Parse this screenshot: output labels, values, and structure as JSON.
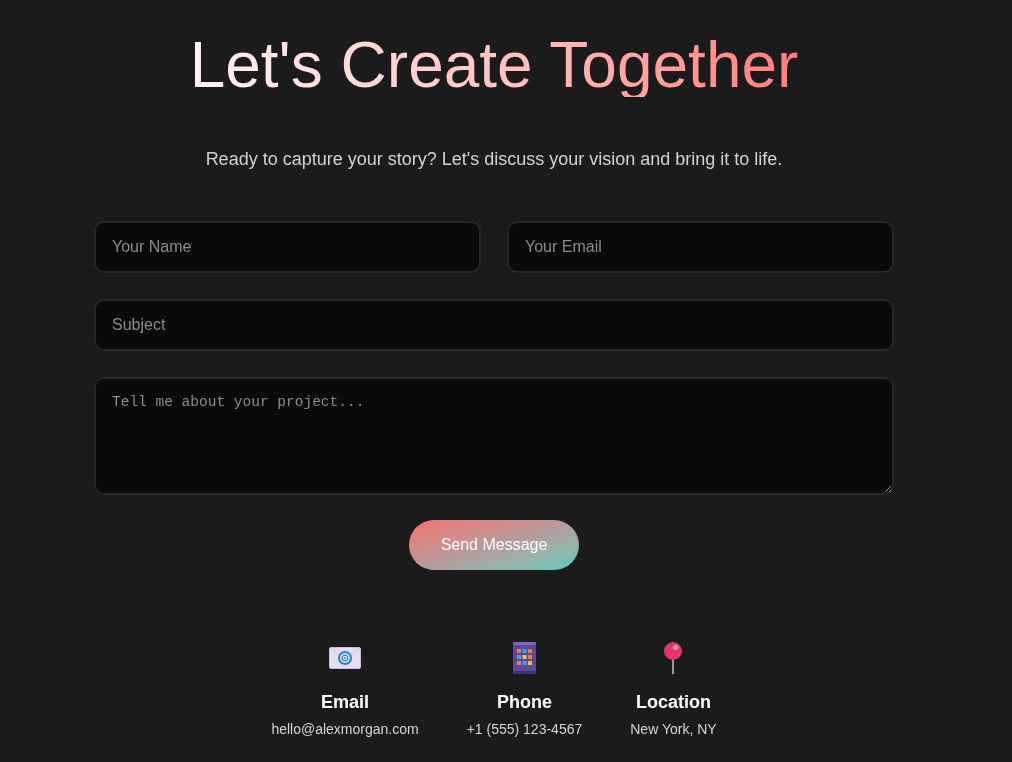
{
  "heading": "Let's Create Together",
  "subtitle": "Ready to capture your story? Let's discuss your vision and bring it to life.",
  "form": {
    "rows": [
      {
        "fields": [
          {
            "kind": "text",
            "placeholder": "Your Name"
          },
          {
            "kind": "text",
            "placeholder": "Your Email"
          }
        ]
      },
      {
        "fields": [
          {
            "kind": "text",
            "placeholder": "Subject"
          }
        ]
      },
      {
        "fields": [
          {
            "kind": "textarea",
            "placeholder": "Tell me about your project..."
          }
        ]
      }
    ],
    "submit": "Send Message"
  },
  "contacts": [
    {
      "kind": "email",
      "title": "Email",
      "value": "hello@alexmorgan.com"
    },
    {
      "kind": "phone",
      "title": "Phone",
      "value": "+1 (555) 123-4567"
    },
    {
      "kind": "location",
      "title": "Location",
      "value": "New York, NY"
    }
  ]
}
